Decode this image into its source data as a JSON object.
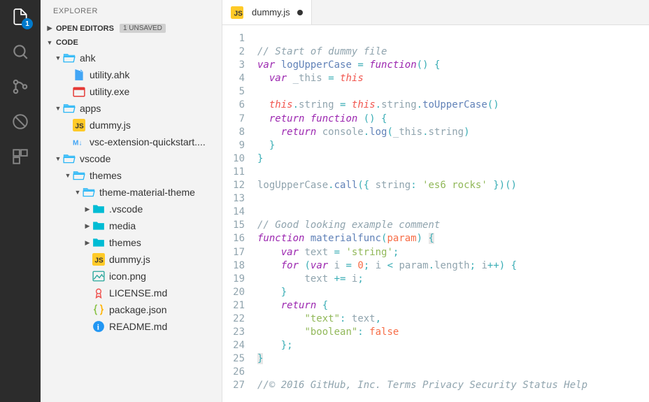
{
  "activityBar": {
    "badge": "1"
  },
  "sidebar": {
    "title": "EXPLORER",
    "sections": {
      "openEditors": {
        "label": "OPEN EDITORS",
        "badge": "1 UNSAVED"
      },
      "workspace": {
        "label": "CODE"
      }
    },
    "tree": [
      {
        "type": "folder",
        "name": "ahk",
        "expanded": true,
        "indent": 0
      },
      {
        "type": "file",
        "name": "utility.ahk",
        "icon": "ahk",
        "indent": 1
      },
      {
        "type": "file",
        "name": "utility.exe",
        "icon": "exe",
        "indent": 1
      },
      {
        "type": "folder",
        "name": "apps",
        "expanded": true,
        "indent": 0
      },
      {
        "type": "file",
        "name": "dummy.js",
        "icon": "js",
        "indent": 1
      },
      {
        "type": "file",
        "name": "vsc-extension-quickstart....",
        "icon": "md-dn",
        "indent": 1
      },
      {
        "type": "folder",
        "name": "vscode",
        "expanded": true,
        "indent": 0
      },
      {
        "type": "folder",
        "name": "themes",
        "expanded": true,
        "indent": 1
      },
      {
        "type": "folder",
        "name": "theme-material-theme",
        "expanded": true,
        "indent": 2
      },
      {
        "type": "folder-collapsed",
        "name": ".vscode",
        "indent": 3,
        "closed": true
      },
      {
        "type": "folder-collapsed",
        "name": "media",
        "indent": 3,
        "closed": true
      },
      {
        "type": "folder-collapsed",
        "name": "themes",
        "indent": 3,
        "closed": true
      },
      {
        "type": "file",
        "name": "dummy.js",
        "icon": "js",
        "indent": 3
      },
      {
        "type": "file",
        "name": "icon.png",
        "icon": "png",
        "indent": 3
      },
      {
        "type": "file",
        "name": "LICENSE.md",
        "icon": "license",
        "indent": 3
      },
      {
        "type": "file",
        "name": "package.json",
        "icon": "json",
        "indent": 3
      },
      {
        "type": "file",
        "name": "README.md",
        "icon": "readme",
        "indent": 3
      }
    ]
  },
  "tab": {
    "filename": "dummy.js",
    "dirty": true
  },
  "code": {
    "lines": [
      {
        "n": 1,
        "html": ""
      },
      {
        "n": 2,
        "html": "<span class='c-comment'>// Start of dummy file</span>"
      },
      {
        "n": 3,
        "html": "<span class='c-storage'>var</span> <span class='c-func'>logUpperCase</span> <span class='c-punct'>=</span> <span class='c-storage'>function</span><span class='c-paren'>()</span> <span class='c-paren'>{</span>"
      },
      {
        "n": 4,
        "html": "  <span class='c-storage'>var</span> <span class='c-var'>_this</span> <span class='c-punct'>=</span> <span class='c-this'>this</span>"
      },
      {
        "n": 5,
        "html": ""
      },
      {
        "n": 6,
        "html": "  <span class='c-this'>this</span><span class='c-punct'>.</span><span class='c-var'>string</span> <span class='c-punct'>=</span> <span class='c-this'>this</span><span class='c-punct'>.</span><span class='c-var'>string</span><span class='c-punct'>.</span><span class='c-func'>toUpperCase</span><span class='c-paren'>()</span>"
      },
      {
        "n": 7,
        "html": "  <span class='c-keyword'>return</span> <span class='c-storage'>function</span> <span class='c-paren'>()</span> <span class='c-paren'>{</span>"
      },
      {
        "n": 8,
        "html": "    <span class='c-keyword'>return</span> <span class='c-var'>console</span><span class='c-punct'>.</span><span class='c-func'>log</span><span class='c-paren'>(</span><span class='c-var'>_this</span><span class='c-punct'>.</span><span class='c-var'>string</span><span class='c-paren'>)</span>"
      },
      {
        "n": 9,
        "html": "  <span class='c-paren'>}</span>"
      },
      {
        "n": 10,
        "html": "<span class='c-paren'>}</span>"
      },
      {
        "n": 11,
        "html": ""
      },
      {
        "n": 12,
        "html": "<span class='c-var'>logUpperCase</span><span class='c-punct'>.</span><span class='c-func'>call</span><span class='c-paren'>({</span> <span class='c-var'>string</span><span class='c-punct'>:</span> <span class='c-string'>'es6 rocks'</span> <span class='c-paren'>})()</span>"
      },
      {
        "n": 13,
        "html": ""
      },
      {
        "n": 14,
        "html": ""
      },
      {
        "n": 15,
        "html": "<span class='c-comment'>// Good looking example comment</span>"
      },
      {
        "n": 16,
        "html": "<span class='c-storage'>function</span> <span class='c-funcname'>materialfunc</span><span class='c-paren'>(</span><span class='c-param'>param</span><span class='c-paren'>)</span> <span class='c-paren c-brack-hl'>{</span>"
      },
      {
        "n": 17,
        "html": "    <span class='c-storage'>var</span> <span class='c-var'>text</span> <span class='c-punct'>=</span> <span class='c-string'>'string'</span><span class='c-punct'>;</span>"
      },
      {
        "n": 18,
        "html": "    <span class='c-keyword'>for</span> <span class='c-paren'>(</span><span class='c-storage'>var</span> <span class='c-var'>i</span> <span class='c-punct'>=</span> <span class='c-number'>0</span><span class='c-punct'>;</span> <span class='c-var'>i</span> <span class='c-punct'>&lt;</span> <span class='c-var'>param</span><span class='c-punct'>.</span><span class='c-var'>length</span><span class='c-punct'>;</span> <span class='c-var'>i</span><span class='c-punct'>++)</span> <span class='c-paren'>{</span>"
      },
      {
        "n": 19,
        "html": "        <span class='c-var'>text</span> <span class='c-punct'>+=</span> <span class='c-var'>i</span><span class='c-punct'>;</span>"
      },
      {
        "n": 20,
        "html": "    <span class='c-paren'>}</span>"
      },
      {
        "n": 21,
        "html": "    <span class='c-keyword'>return</span> <span class='c-paren'>{</span>"
      },
      {
        "n": 22,
        "html": "        <span class='c-string'>\"text\"</span><span class='c-punct'>:</span> <span class='c-var'>text</span><span class='c-punct'>,</span>"
      },
      {
        "n": 23,
        "html": "        <span class='c-string'>\"boolean\"</span><span class='c-punct'>:</span> <span class='c-bool'>false</span>"
      },
      {
        "n": 24,
        "html": "    <span class='c-paren'>};</span>"
      },
      {
        "n": 25,
        "html": "<span class='c-paren c-brack-hl'>}</span>"
      },
      {
        "n": 26,
        "html": ""
      },
      {
        "n": 27,
        "html": "<span class='c-comment'>//© 2016 GitHub, Inc. Terms Privacy Security Status Help</span>"
      }
    ]
  }
}
